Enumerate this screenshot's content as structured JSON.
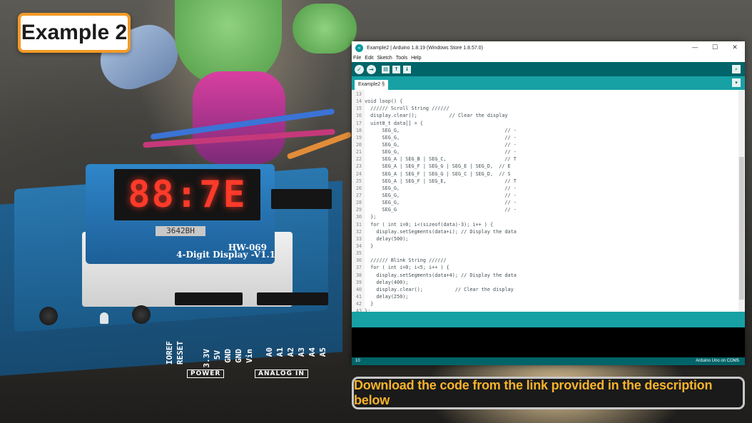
{
  "badge": {
    "text": "Example 2"
  },
  "caption": {
    "text": "Download the code from the link provided in the description below"
  },
  "photo": {
    "display_digits": "88:7E",
    "display_part": "3642BH",
    "display_model": "HW-069",
    "display_name": "4-Digit Display -V1.1",
    "header_labels": [
      "A5",
      "A4",
      "A3",
      "A2",
      "A1",
      "A0",
      "Vin",
      "GND",
      "GND",
      "5V",
      "3.3V",
      "RESET",
      "IOREF"
    ],
    "silk_power": "POWER",
    "silk_analog": "ANALOG IN"
  },
  "ide": {
    "title": "Example2 | Arduino 1.8.19 (Windows Store 1.8.57.0)",
    "controls": {
      "minimize": "—",
      "maximize": "☐",
      "close": "✕"
    },
    "menu": [
      "File",
      "Edit",
      "Sketch",
      "Tools",
      "Help"
    ],
    "toolbar_icons": [
      "verify-icon",
      "upload-icon",
      "new-icon",
      "open-icon",
      "save-icon",
      "serial-monitor-icon"
    ],
    "tab_label": "Example2 §",
    "status_line": "10",
    "status_board": "Arduino Uno on COM5",
    "colors": {
      "toolbar": "#006468",
      "tabbar": "#17a1a5",
      "keyword": "#d35400",
      "type": "#00979c"
    },
    "code": [
      {
        "ln": "13",
        "text": ""
      },
      {
        "ln": "14",
        "text": "void loop() {"
      },
      {
        "ln": "15",
        "text": "  ////// Scroll String //////"
      },
      {
        "ln": "16",
        "text": "  display.clear();           // Clear the display"
      },
      {
        "ln": "17",
        "text": "  uint8_t data[] = {"
      },
      {
        "ln": "18",
        "text": "      SEG_G,                                    // -"
      },
      {
        "ln": "19",
        "text": "      SEG_G,                                    // -"
      },
      {
        "ln": "20",
        "text": "      SEG_G,                                    // -"
      },
      {
        "ln": "21",
        "text": "      SEG_G,                                    // -"
      },
      {
        "ln": "22",
        "text": "      SEG_A | SEG_B | SEG_C,                    // T"
      },
      {
        "ln": "23",
        "text": "      SEG_A | SEG_F | SEG_G | SEG_E | SEG_D,  // E"
      },
      {
        "ln": "24",
        "text": "      SEG_A | SEG_F | SEG_G | SEG_C | SEG_D,  // S"
      },
      {
        "ln": "25",
        "text": "      SEG_A | SEG_F | SEG_E,                    // T"
      },
      {
        "ln": "26",
        "text": "      SEG_G,                                    // -"
      },
      {
        "ln": "27",
        "text": "      SEG_G,                                    // -"
      },
      {
        "ln": "28",
        "text": "      SEG_G,                                    // -"
      },
      {
        "ln": "29",
        "text": "      SEG_G                                     // -"
      },
      {
        "ln": "30",
        "text": "  };"
      },
      {
        "ln": "31",
        "text": "  for ( int i=0; i<(sizeof(data)-3); i++ ) {"
      },
      {
        "ln": "32",
        "text": "    display.setSegments(data+i); // Display the data"
      },
      {
        "ln": "33",
        "text": "    delay(500);"
      },
      {
        "ln": "34",
        "text": "  }"
      },
      {
        "ln": "35",
        "text": ""
      },
      {
        "ln": "36",
        "text": "  ////// Blink String //////"
      },
      {
        "ln": "37",
        "text": "  for ( int i=0; i<5; i++ ) {"
      },
      {
        "ln": "38",
        "text": "    display.setSegments(data+4); // Display the data"
      },
      {
        "ln": "39",
        "text": "    delay(400);"
      },
      {
        "ln": "40",
        "text": "    display.clear();           // Clear the display"
      },
      {
        "ln": "41",
        "text": "    delay(250);"
      },
      {
        "ln": "42",
        "text": "  }"
      },
      {
        "ln": "43",
        "text": "};"
      }
    ]
  }
}
